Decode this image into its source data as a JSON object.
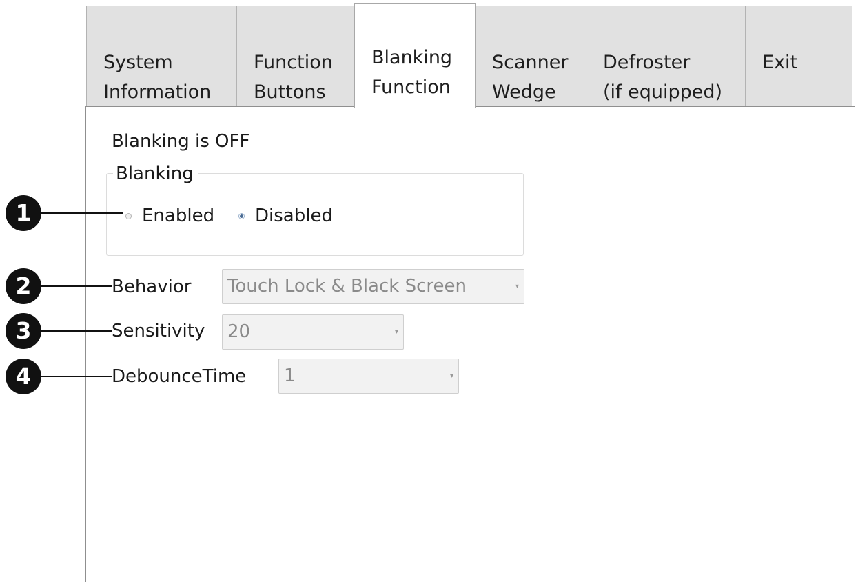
{
  "tabs": [
    {
      "label": "System\nInformation",
      "active": false
    },
    {
      "label": "Function\nButtons",
      "active": false
    },
    {
      "label": "Blanking\nFunction",
      "active": true
    },
    {
      "label": "Scanner\nWedge",
      "active": false
    },
    {
      "label": "Defroster\n(if equipped)",
      "active": false
    },
    {
      "label": "Exit",
      "active": false
    }
  ],
  "status_text": "Blanking is OFF",
  "blanking_group": {
    "title": "Blanking",
    "options": [
      {
        "label": "Enabled",
        "checked": false
      },
      {
        "label": "Disabled",
        "checked": true
      }
    ]
  },
  "fields": {
    "behavior": {
      "label": "Behavior",
      "value": "Touch Lock & Black Screen",
      "arrow": "▾"
    },
    "sensitivity": {
      "label": "Sensitivity",
      "value": "20",
      "arrow": "▾"
    },
    "debounce": {
      "label": "DebounceTime",
      "value": "1",
      "arrow": "▾"
    }
  },
  "callouts": [
    "1",
    "2",
    "3",
    "4"
  ]
}
